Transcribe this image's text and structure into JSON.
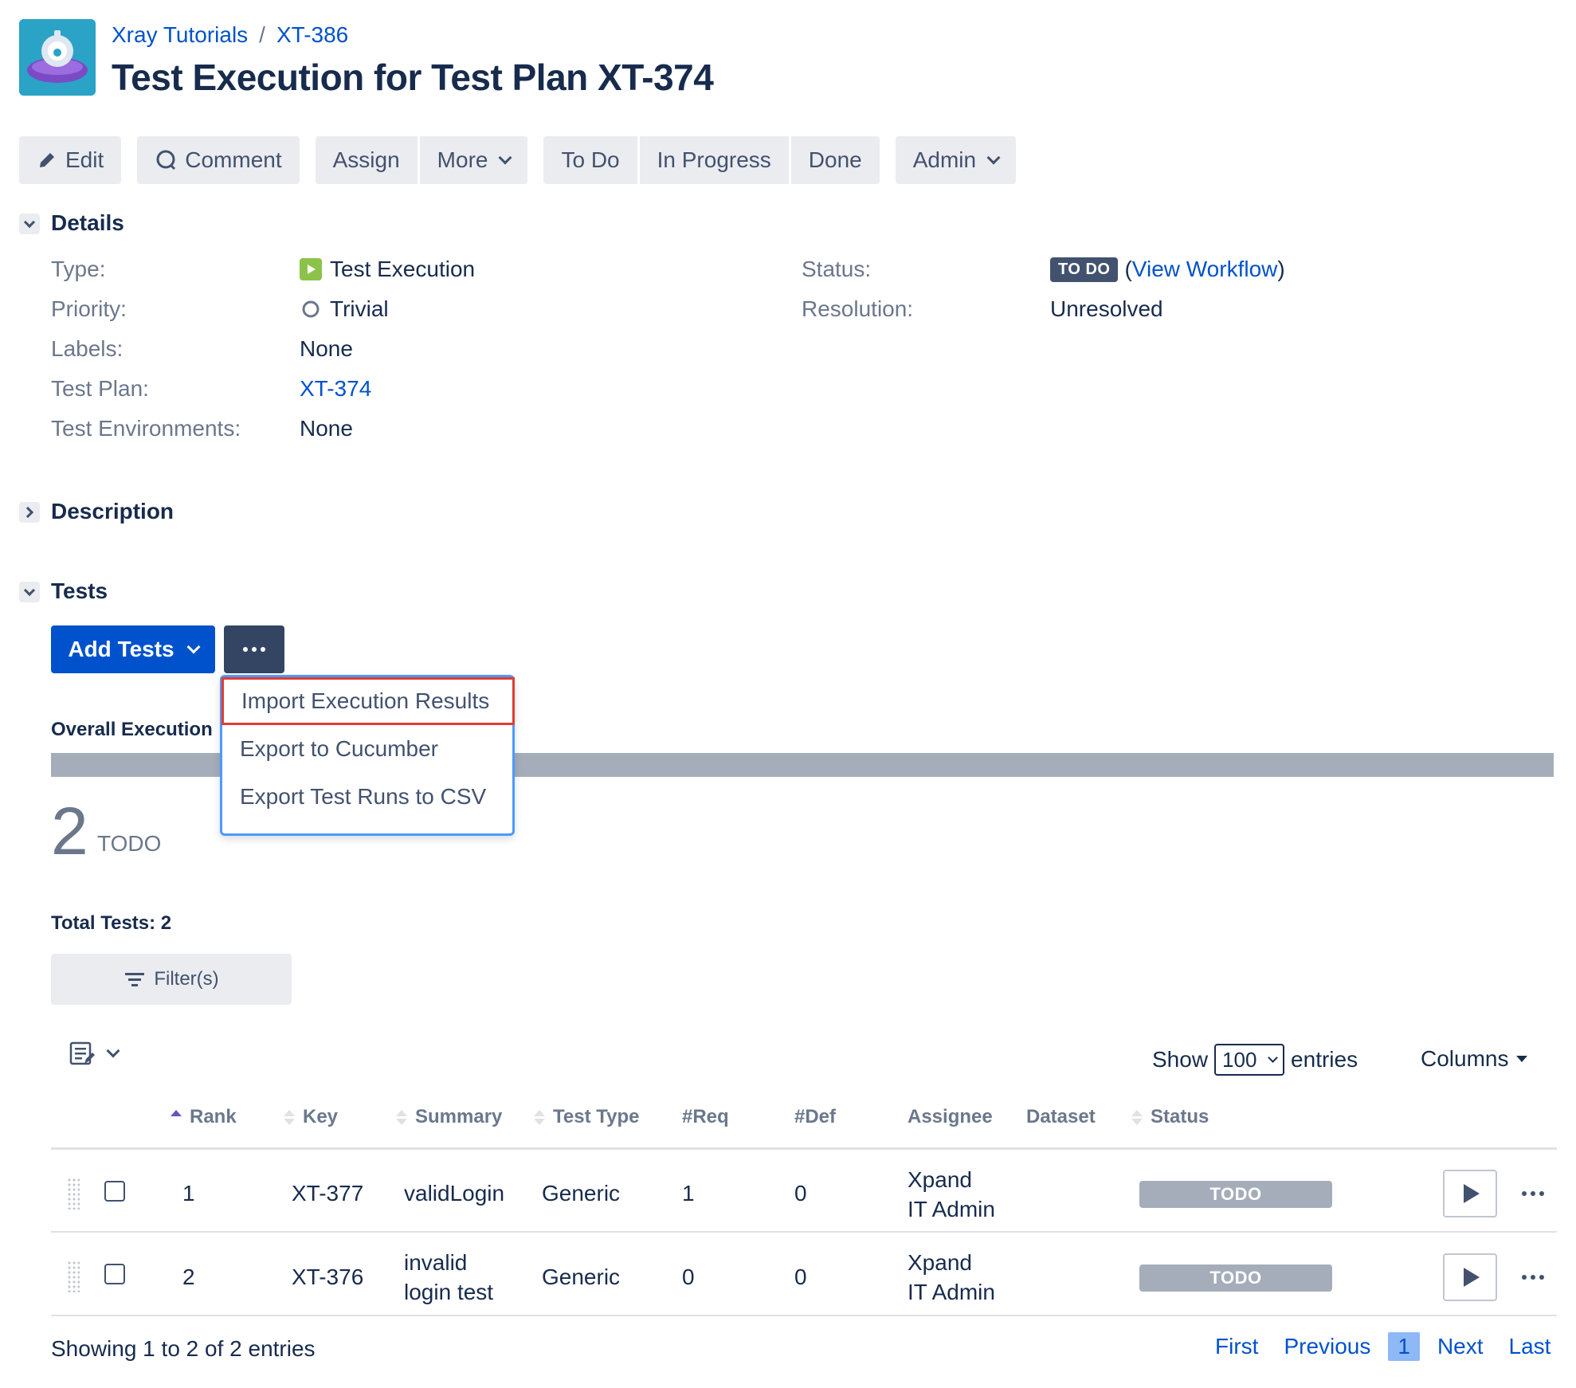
{
  "header": {
    "breadcrumb": [
      "Xray Tutorials",
      "XT-386"
    ],
    "breadcrumb_sep": "/",
    "title": "Test Execution for Test Plan XT-374"
  },
  "toolbar": {
    "edit": "Edit",
    "comment": "Comment",
    "assign": "Assign",
    "more": "More",
    "todo": "To Do",
    "in_progress": "In Progress",
    "done": "Done",
    "admin": "Admin"
  },
  "details": {
    "heading": "Details",
    "fields": {
      "type_label": "Type:",
      "type_value": "Test Execution",
      "priority_label": "Priority:",
      "priority_value": "Trivial",
      "labels_label": "Labels:",
      "labels_value": "None",
      "test_plan_label": "Test Plan:",
      "test_plan_value": "XT-374",
      "test_env_label": "Test Environments:",
      "test_env_value": "None",
      "status_label": "Status:",
      "status_value": "TO DO",
      "view_workflow_open": "(",
      "view_workflow": "View Workflow",
      "view_workflow_close": ")",
      "resolution_label": "Resolution:",
      "resolution_value": "Unresolved"
    }
  },
  "description": {
    "heading": "Description"
  },
  "tests": {
    "heading": "Tests",
    "add_tests": "Add Tests",
    "dropdown": [
      "Import Execution Results",
      "Export to Cucumber",
      "Export Test Runs to CSV"
    ],
    "overall_label": "Overall Execution",
    "count": "2",
    "count_status": "TODO",
    "total": "Total Tests: 2",
    "filter": "Filter(s)",
    "show": "Show",
    "entries_value": "100",
    "entries": "entries",
    "columns": "Columns",
    "headers": [
      "Rank",
      "Key",
      "Summary",
      "Test Type",
      "#Req",
      "#Def",
      "Assignee",
      "Dataset",
      "Status"
    ],
    "rows": [
      {
        "rank": "1",
        "key": "XT-377",
        "summary_l1": "validLogin",
        "summary_l2": "",
        "type": "Generic",
        "req": "1",
        "def": "0",
        "assignee_l1": "Xpand",
        "assignee_l2": "IT Admin",
        "status": "TODO"
      },
      {
        "rank": "2",
        "key": "XT-376",
        "summary_l1": "invalid",
        "summary_l2": "login test",
        "type": "Generic",
        "req": "0",
        "def": "0",
        "assignee_l1": "Xpand",
        "assignee_l2": "IT Admin",
        "status": "TODO"
      }
    ],
    "showing": "Showing 1 to 2 of 2 entries",
    "pagination": {
      "first": "First",
      "previous": "Previous",
      "current": "1",
      "next": "Next",
      "last": "Last"
    }
  },
  "colors": {
    "accent": "#0052cc",
    "todo": "#a5adba",
    "dropdown_border": "#4c9aff",
    "highlight": "#e03c31"
  }
}
